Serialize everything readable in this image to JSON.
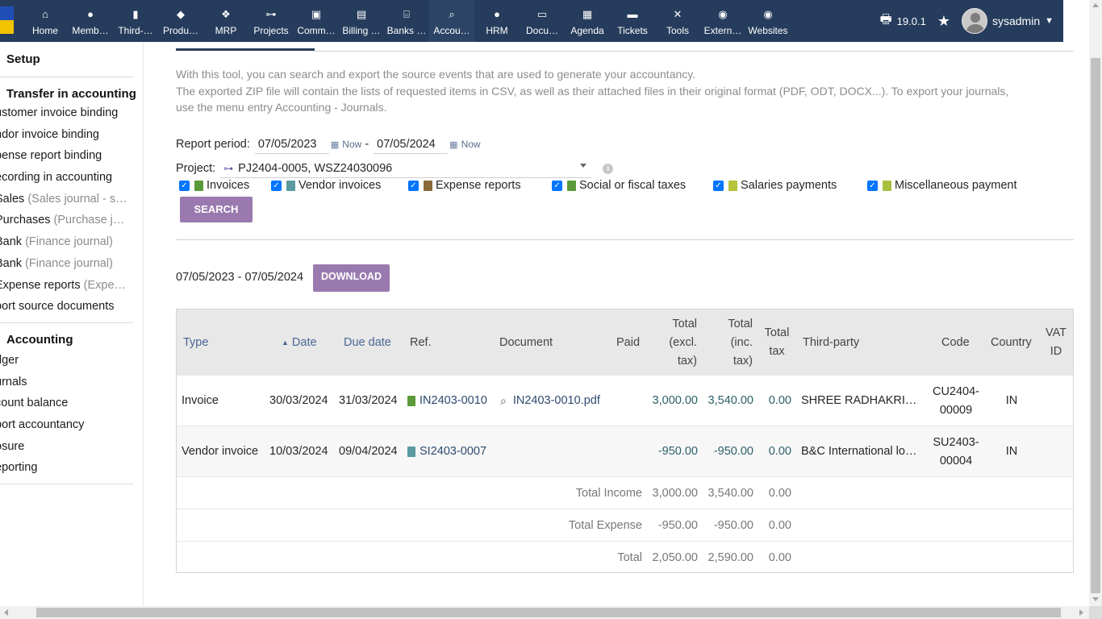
{
  "topbar": {
    "menu": [
      {
        "label": "Home",
        "icon": "home-icon",
        "glyph": "⌂"
      },
      {
        "label": "Memb…",
        "icon": "user-icon",
        "glyph": "●"
      },
      {
        "label": "Third-…",
        "icon": "building-icon",
        "glyph": "▮"
      },
      {
        "label": "Produ…",
        "icon": "cube-icon",
        "glyph": "◆"
      },
      {
        "label": "MRP",
        "icon": "cubes-icon",
        "glyph": "❖"
      },
      {
        "label": "Projects",
        "icon": "sitemap-icon",
        "glyph": "⊶"
      },
      {
        "label": "Comm…",
        "icon": "suitcase-icon",
        "glyph": "▣"
      },
      {
        "label": "Billing …",
        "icon": "file-invoice-icon",
        "glyph": "▤"
      },
      {
        "label": "Banks …",
        "icon": "bank-icon",
        "glyph": "⌸"
      },
      {
        "label": "Accou…",
        "icon": "search-dollar-icon",
        "glyph": "⌕"
      },
      {
        "label": "HRM",
        "icon": "user-tie-icon",
        "glyph": "●"
      },
      {
        "label": "Docu…",
        "icon": "folder-open-icon",
        "glyph": "▭"
      },
      {
        "label": "Agenda",
        "icon": "calendar-icon",
        "glyph": "▦"
      },
      {
        "label": "Tickets",
        "icon": "ticket-icon",
        "glyph": "▬"
      },
      {
        "label": "Tools",
        "icon": "tools-icon",
        "glyph": "✕"
      },
      {
        "label": "Extern…",
        "icon": "globe-icon",
        "glyph": "◉"
      },
      {
        "label": "Websites",
        "icon": "globe-icon",
        "glyph": "◉"
      }
    ],
    "active_index": 9,
    "version": "19.0.1",
    "username": "sysadmin",
    "bg_color": "#263c5c"
  },
  "sidebar": {
    "setup": "Setup",
    "transfer_heading": "Transfer in accounting",
    "transfer_items": [
      {
        "label": "ustomer invoice binding",
        "muted": ""
      },
      {
        "label": "ndor invoice binding",
        "muted": ""
      },
      {
        "label": "pense report binding",
        "muted": ""
      },
      {
        "label": "ecording in accounting",
        "muted": ""
      },
      {
        "label": "Sales ",
        "muted": "(Sales journal - s…"
      },
      {
        "label": "Purchases ",
        "muted": "(Purchase j…"
      },
      {
        "label": "Bank ",
        "muted": "(Finance journal)"
      },
      {
        "label": "Bank ",
        "muted": "(Finance journal)"
      },
      {
        "label": "Expense reports ",
        "muted": "(Expe…"
      },
      {
        "label": "port source documents",
        "muted": ""
      }
    ],
    "accounting_heading": "Accounting",
    "accounting_items": [
      "dger",
      "urnals",
      "count balance",
      "port accountancy",
      "osure",
      "eporting"
    ]
  },
  "main": {
    "intro_line1": "With this tool, you can search and export the source events that are used to generate your accountancy.",
    "intro_line2": "The exported ZIP file will contain the lists of requested items in CSV, as well as their attached files in their original format (PDF, ODT, DOCX...). To export your journals,",
    "intro_line3": "use the menu entry Accounting - Journals.",
    "report_period_label": "Report period:",
    "date_from": "07/05/2023",
    "date_to": "07/05/2024",
    "now_label": "Now",
    "dash": "-",
    "project_label": "Project:",
    "project_value": "PJ2404-0005, WSZ24030096",
    "checkboxes": [
      {
        "label": "Invoices",
        "color": "#5a9a3a"
      },
      {
        "label": "Vendor invoices",
        "color": "#5a9aa0"
      },
      {
        "label": "Expense reports",
        "color": "#8a6a3a"
      },
      {
        "label": "Social or fiscal taxes",
        "color": "#5a9a3a"
      },
      {
        "label": "Salaries payments",
        "color": "#b5c23a"
      },
      {
        "label": "Miscellaneous payment",
        "color": "#a8c040"
      }
    ],
    "search_button": "SEARCH",
    "range_text": "07/05/2023 - 07/05/2024",
    "download_button": "DOWNLOAD",
    "accent_color": "#9a7aae"
  },
  "table": {
    "headers": {
      "type": "Type",
      "date": "Date",
      "due_date": "Due date",
      "ref": "Ref.",
      "document": "Document",
      "paid": "Paid",
      "total_excl_1": "Total",
      "total_excl_2": "(excl.",
      "total_excl_3": "tax)",
      "total_inc_1": "Total",
      "total_inc_2": "(inc.",
      "total_inc_3": "tax)",
      "total_tax_1": "Total",
      "total_tax_2": "tax",
      "third_party": "Third-party",
      "code": "Code",
      "country": "Country",
      "vat_1": "VAT",
      "vat_2": "ID"
    },
    "rows": [
      {
        "type": "Invoice",
        "date": "30/03/2024",
        "due_date": "31/03/2024",
        "ref": "IN2403-0010",
        "document": "IN2403-0010.pdf",
        "paid": "",
        "total_excl": "3,000.00",
        "total_inc": "3,540.00",
        "total_tax": "0.00",
        "third_party": "SHREE RADHAKRI…",
        "code_1": "CU2404-",
        "code_2": "00009",
        "country": "IN",
        "vat": ""
      },
      {
        "type": "Vendor invoice",
        "date": "10/03/2024",
        "due_date": "09/04/2024",
        "ref": "SI2403-0007",
        "document": "",
        "paid": "",
        "total_excl": "-950.00",
        "total_inc": "-950.00",
        "total_tax": "0.00",
        "third_party": "B&C International lo…",
        "code_1": "SU2403-",
        "code_2": "00004",
        "country": "IN",
        "vat": ""
      }
    ],
    "totals": [
      {
        "label": "Total Income",
        "excl": "3,000.00",
        "inc": "3,540.00",
        "tax": "0.00"
      },
      {
        "label": "Total Expense",
        "excl": "-950.00",
        "inc": "-950.00",
        "tax": "0.00"
      },
      {
        "label": "Total",
        "excl": "2,050.00",
        "inc": "2,590.00",
        "tax": "0.00"
      }
    ]
  }
}
